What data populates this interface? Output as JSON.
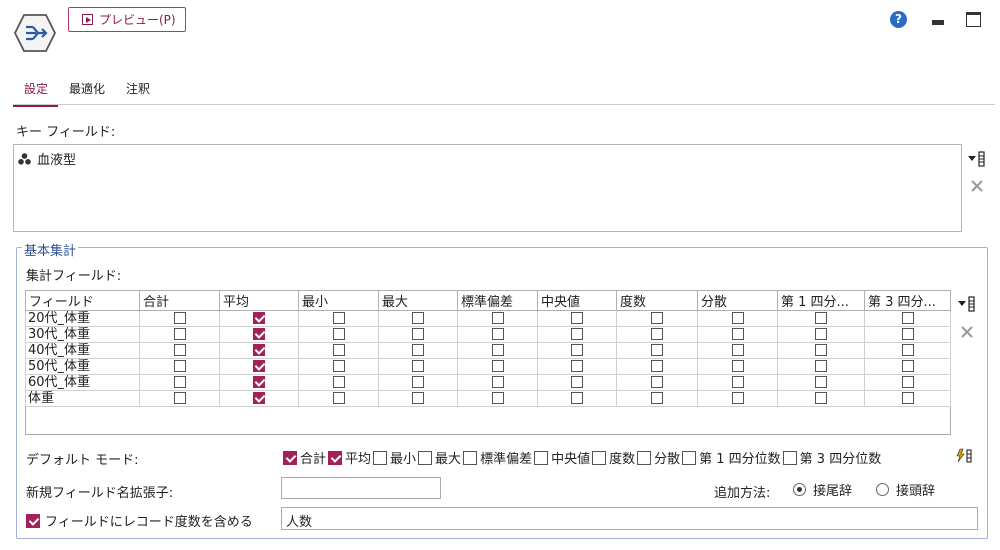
{
  "header": {
    "preview_label": "プレビュー(P)",
    "help_glyph": "?"
  },
  "tabs": [
    {
      "label": "設定",
      "active": true
    },
    {
      "label": "最適化",
      "active": false
    },
    {
      "label": "注釈",
      "active": false
    }
  ],
  "key_fields": {
    "label": "キー フィールド:",
    "items": [
      "血液型"
    ]
  },
  "basic_agg": {
    "title": "基本集計",
    "agg_fields_label": "集計フィールド:",
    "columns": [
      "フィールド",
      "合計",
      "平均",
      "最小",
      "最大",
      "標準偏差",
      "中央値",
      "度数",
      "分散",
      "第 1 四分...",
      "第 3 四分..."
    ],
    "rows": [
      {
        "field": "20代_体重",
        "checks": [
          false,
          true,
          false,
          false,
          false,
          false,
          false,
          false,
          false,
          false
        ]
      },
      {
        "field": "30代_体重",
        "checks": [
          false,
          true,
          false,
          false,
          false,
          false,
          false,
          false,
          false,
          false
        ]
      },
      {
        "field": "40代_体重",
        "checks": [
          false,
          true,
          false,
          false,
          false,
          false,
          false,
          false,
          false,
          false
        ]
      },
      {
        "field": "50代_体重",
        "checks": [
          false,
          true,
          false,
          false,
          false,
          false,
          false,
          false,
          false,
          false
        ]
      },
      {
        "field": "60代_体重",
        "checks": [
          false,
          true,
          false,
          false,
          false,
          false,
          false,
          false,
          false,
          false
        ]
      },
      {
        "field": "体重",
        "checks": [
          false,
          true,
          false,
          false,
          false,
          false,
          false,
          false,
          false,
          false
        ]
      }
    ],
    "default_mode_label": "デフォルト モード:",
    "default_mode": [
      {
        "label": "合計",
        "checked": true
      },
      {
        "label": "平均",
        "checked": true
      },
      {
        "label": "最小",
        "checked": false
      },
      {
        "label": "最大",
        "checked": false
      },
      {
        "label": "標準偏差",
        "checked": false
      },
      {
        "label": "中央値",
        "checked": false
      },
      {
        "label": "度数",
        "checked": false
      },
      {
        "label": "分散",
        "checked": false
      },
      {
        "label": "第 1 四分位数",
        "checked": false
      },
      {
        "label": "第 3 四分位数",
        "checked": false
      }
    ],
    "suffix_label": "新規フィールド名拡張子:",
    "suffix_value": "",
    "add_method_label": "追加方法:",
    "add_method_options": [
      {
        "label": "接尾辞",
        "selected": true
      },
      {
        "label": "接頭辞",
        "selected": false
      }
    ],
    "include_count_label": "フィールドにレコード度数を含める",
    "include_count_checked": true,
    "count_field_value": "人数"
  }
}
